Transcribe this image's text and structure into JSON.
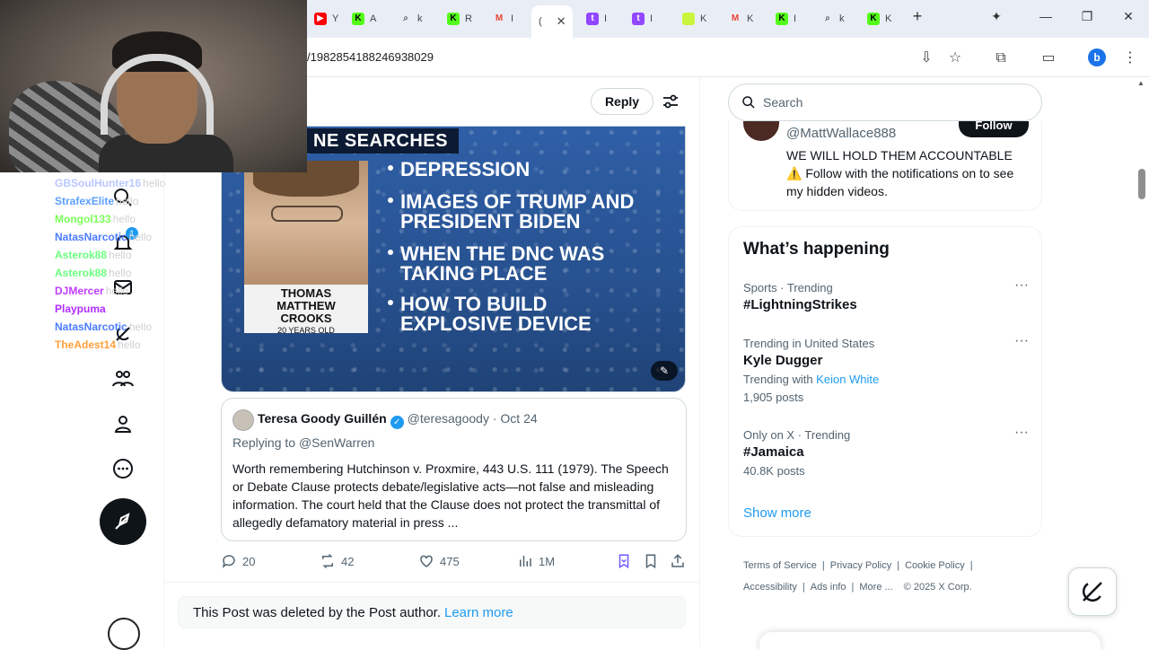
{
  "browser": {
    "tabs": [
      {
        "label": "Y",
        "icon": "youtube-icon",
        "color": "#ff0000"
      },
      {
        "label": "A",
        "icon": "kick-icon",
        "color": "#53fc18"
      },
      {
        "label": "k",
        "icon": "search-icon",
        "color": "#5f6368"
      },
      {
        "label": "R",
        "icon": "kick-icon",
        "color": "#53fc18"
      },
      {
        "label": "I",
        "icon": "gmail-icon",
        "color": "#ea4335"
      },
      {
        "label": "(",
        "icon": "x-icon",
        "color": "#0f1419",
        "active": true
      },
      {
        "label": "I",
        "icon": "twitch-icon",
        "color": "#9146ff"
      },
      {
        "label": "I",
        "icon": "twitch-icon",
        "color": "#9146ff"
      },
      {
        "label": "K",
        "icon": "kick-icon",
        "color": "#53fc18"
      },
      {
        "label": "K",
        "icon": "gmail-icon",
        "color": "#ea4335"
      },
      {
        "label": "I",
        "icon": "kick-icon",
        "color": "#53fc18"
      },
      {
        "label": "k",
        "icon": "search-icon",
        "color": "#5f6368"
      },
      {
        "label": "K",
        "icon": "kick-icon",
        "color": "#53fc18"
      }
    ],
    "new_tab": "+",
    "url": "/1982854188246938029",
    "profile_letter": "b"
  },
  "webcam_chat": [
    {
      "user": "GBSoulHunter16",
      "msg": "hello",
      "color": "#b9c7ff"
    },
    {
      "user": "StrafexElite",
      "msg": "hello",
      "color": "#5aa0ff"
    },
    {
      "user": "Mongol133",
      "msg": "hello",
      "color": "#7cff5a"
    },
    {
      "user": "NatasNarcotic",
      "msg": "hello",
      "color": "#4b7cff"
    },
    {
      "user": "Asterok88",
      "msg": "hello",
      "color": "#6cff80"
    },
    {
      "user": "Asterok88",
      "msg": "hello",
      "color": "#6cff80"
    },
    {
      "user": "DJMercer",
      "msg": "hello",
      "color": "#c03cff"
    },
    {
      "user": "Playpuma",
      "msg": "",
      "color": "#b02cff"
    },
    {
      "user": "NatasNarcotic",
      "msg": "hello",
      "color": "#4b7cff"
    },
    {
      "user": "TheAdest14",
      "msg": "hello",
      "color": "#ffa13c"
    }
  ],
  "nav": {
    "notifications_badge": "1"
  },
  "post": {
    "reply_label": "Reply",
    "media": {
      "headline": "NE SEARCHES",
      "bullets": [
        "DEPRESSION",
        "IMAGES OF TRUMP AND PRESIDENT BIDEN",
        "WHEN THE DNC WAS TAKING PLACE",
        "HOW TO BUILD EXPLOSIVE DEVICE"
      ],
      "name_line1": "THOMAS",
      "name_line2": "MATTHEW",
      "name_line3": "CROOKS",
      "age": "20 YEARS OLD"
    },
    "quote": {
      "name": "Teresa Goody Guillén",
      "handle": "@teresagoody",
      "dot": "·",
      "date": "Oct 24",
      "replying_prefix": "Replying to ",
      "replying_to": "@SenWarren",
      "body": "Worth remembering Hutchinson v. Proxmire, 443 U.S. 111 (1979). The Speech or Debate Clause protects debate/legislative acts—not false and misleading information. The court held that the Clause does not protect the transmittal of allegedly defamatory material in press ..."
    },
    "actions": {
      "replies": "20",
      "reposts": "42",
      "likes": "475",
      "views": "1M"
    }
  },
  "deleted_notice": {
    "text": "This Post was deleted by the Post author.",
    "link": "Learn more"
  },
  "sidebar": {
    "search_placeholder": "Search",
    "who_to_follow": {
      "follow_label": "Follow",
      "handle": "@MattWallace888",
      "bio": "WE WILL HOLD THEM ACCOUNTABLE ⚠️ Follow with the notifications on to see my hidden videos."
    },
    "happening": {
      "title": "What’s happening",
      "trends": [
        {
          "meta": "Sports · Trending",
          "name": "#LightningStrikes",
          "extra_prefix": "",
          "extra_link": "",
          "posts": ""
        },
        {
          "meta": "Trending in United States",
          "name": "Kyle Dugger",
          "extra_prefix": "Trending with ",
          "extra_link": "Keion White",
          "posts": "1,905 posts"
        },
        {
          "meta": "Only on X · Trending",
          "name": "#Jamaica",
          "extra_prefix": "",
          "extra_link": "",
          "posts": "40.8K posts"
        }
      ],
      "show_more": "Show more"
    },
    "footer": {
      "terms": "Terms of Service",
      "privacy": "Privacy Policy",
      "cookie": "Cookie Policy",
      "accessibility": "Accessibility",
      "ads": "Ads info",
      "more": "More ...",
      "copyright": "© 2025 X Corp."
    }
  }
}
